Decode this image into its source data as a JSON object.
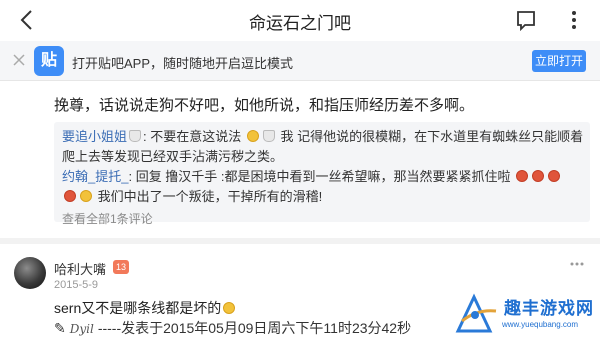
{
  "nav": {
    "back_icon": "chevron-left-icon",
    "title": "命运石之门吧",
    "comment_icon": "comment-icon",
    "more_icon": "more-vertical-icon"
  },
  "banner": {
    "logo_text": "贴",
    "promo_text": "打开贴吧APP，随时随地开启逗比模式",
    "open_button": "立即打开"
  },
  "post1": {
    "text": "挽尊，话说说走狗不好吧，如他所说，和指压师经历差不多啊。"
  },
  "sub_comments": {
    "items": [
      {
        "user": "要追小姐姐",
        "text1": ": 不要在意这说法",
        "text2": "我 记得他说的很模糊，在下水道里有蜘蛛丝只能顺着",
        "text3": "爬上去等发现已经双手沾满污秽之类。"
      },
      {
        "user": "约翰_提托_",
        "text1": ": 回复 撸汉千手 :都是困境中看到一丝希望嘛，那当然要紧紧抓住啦",
        "text2": "我们中出了一个叛徒，干掉所有的滑稽!"
      }
    ],
    "view_all": "查看全部1条评论"
  },
  "post2": {
    "username": "哈利大嘴",
    "level": "13",
    "date": "2015-5-9",
    "text": "sern又不是哪条线都是坏的",
    "sig_prefix": "✎",
    "sig_text": "-----发表于2015年05月09日周六下午11时23分42秒"
  },
  "watermark": {
    "name": "趣丰游戏网",
    "url": "www.yuequbang.com"
  },
  "colors": {
    "brand_blue": "#3e8df7",
    "link_blue": "#3b6db5",
    "level_badge": "#f2795a"
  }
}
